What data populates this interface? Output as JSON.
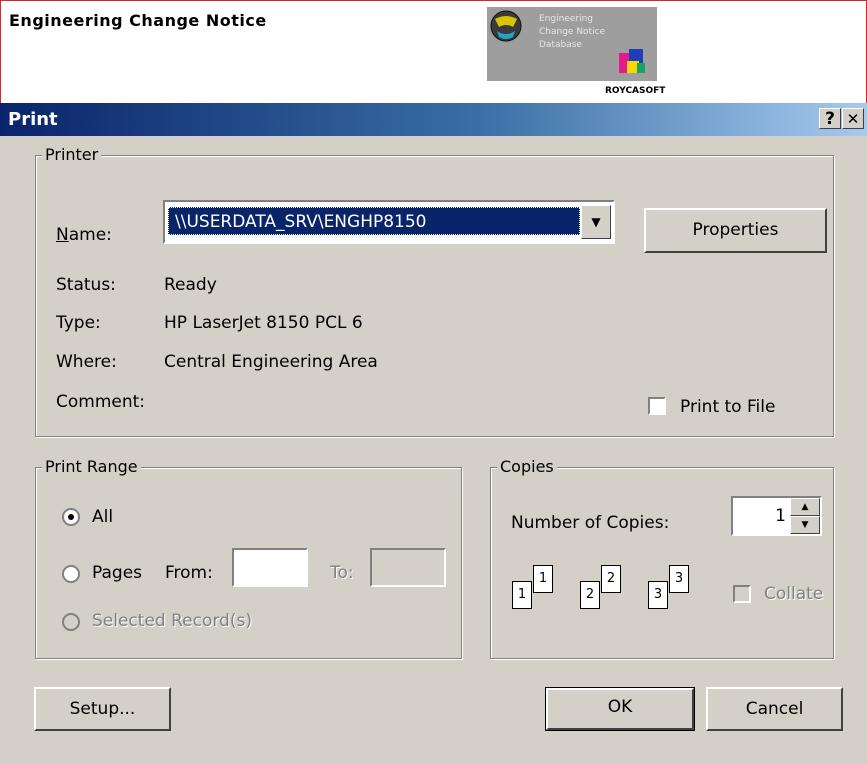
{
  "app": {
    "title": "Engineering Change Notice",
    "logo_lines": [
      "Engineering",
      "Change Notice",
      "Database"
    ],
    "brand": "ROYCASOFT"
  },
  "dialog": {
    "title": "Print",
    "help_button": "?",
    "close_button": "✕",
    "printer": {
      "legend": "Printer",
      "name_label": "Name:",
      "name_value": "\\\\USERDATA_SRV\\ENGHP8150",
      "properties_label": "Properties",
      "status_label": "Status:",
      "status_value": "Ready",
      "type_label": "Type:",
      "type_value": "HP LaserJet 8150 PCL 6",
      "where_label": "Where:",
      "where_value": "Central Engineering Area",
      "comment_label": "Comment:",
      "comment_value": "",
      "print_to_file_label": "Print to File",
      "print_to_file_checked": false
    },
    "print_range": {
      "legend": "Print Range",
      "all_label": "All",
      "pages_label": "Pages",
      "from_label": "From:",
      "from_value": "",
      "to_label": "To:",
      "to_value": "",
      "selected_label": "Selected Record(s)",
      "selected_option": "All"
    },
    "copies": {
      "legend": "Copies",
      "number_label": "Number of Copies:",
      "number_value": "1",
      "collate_label": "Collate",
      "collate_checked": false,
      "page_numbers": [
        "1",
        "1",
        "2",
        "2",
        "3",
        "3"
      ]
    },
    "buttons": {
      "setup": "Setup...",
      "ok": "OK",
      "cancel": "Cancel"
    }
  }
}
